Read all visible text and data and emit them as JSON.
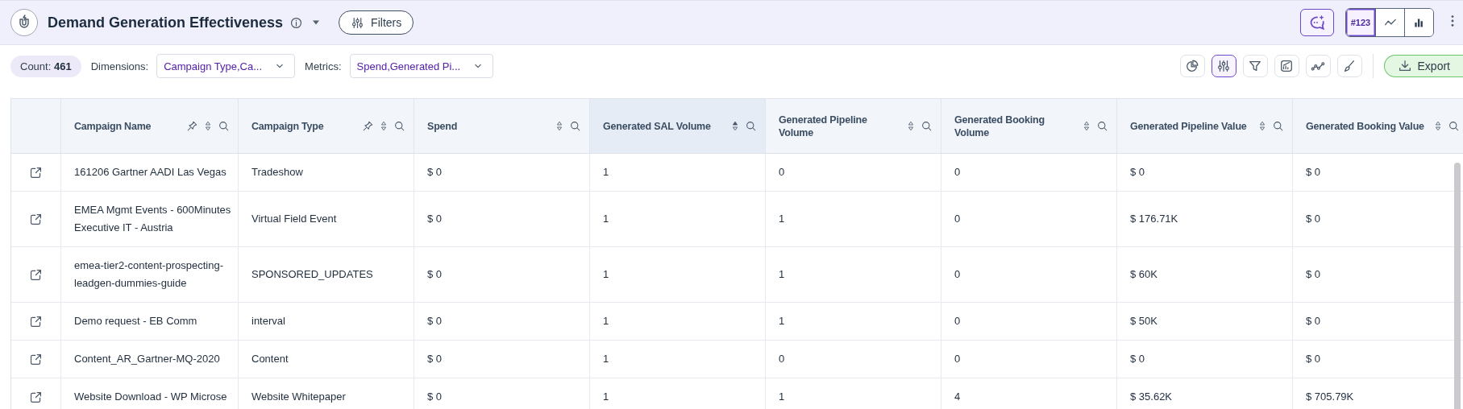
{
  "header": {
    "title": "Demand Generation Effectiveness",
    "filters_button": "Filters",
    "view_modes": [
      {
        "kind": "number",
        "label": "#123",
        "selected": true
      },
      {
        "kind": "line",
        "selected": false
      },
      {
        "kind": "bar",
        "selected": false
      }
    ]
  },
  "toolbar": {
    "count_label": "Count:",
    "count": "461",
    "dimensions_label": "Dimensions:",
    "dimensions_value": "Campaign Type,Ca...",
    "metrics_label": "Metrics:",
    "metrics_value": "Spend,Generated Pi...",
    "tools": [
      {
        "kind": "pie",
        "selected": false
      },
      {
        "kind": "sliders",
        "selected": true
      },
      {
        "kind": "funnel",
        "selected": false
      },
      {
        "kind": "chart",
        "selected": false
      },
      {
        "kind": "trend",
        "selected": false
      },
      {
        "kind": "brush",
        "selected": false
      }
    ],
    "export_button": "Export"
  },
  "table": {
    "columns": [
      {
        "label": "Campaign Name",
        "pinnable": true,
        "sorted": false
      },
      {
        "label": "Campaign Type",
        "pinnable": true,
        "sorted": false
      },
      {
        "label": "Spend",
        "pinnable": false,
        "sorted": false
      },
      {
        "label": "Generated SAL Volume",
        "pinnable": false,
        "sorted": true
      },
      {
        "label": "Generated Pipeline Volume",
        "pinnable": false,
        "sorted": false
      },
      {
        "label": "Generated Booking Volume",
        "pinnable": false,
        "sorted": false
      },
      {
        "label": "Generated Pipeline Value",
        "pinnable": false,
        "sorted": false
      },
      {
        "label": "Generated Booking Value",
        "pinnable": false,
        "sorted": false
      }
    ],
    "rows": [
      [
        "161206 Gartner AADI Las Vegas",
        "Tradeshow",
        "$ 0",
        "1",
        "0",
        "0",
        "$ 0",
        "$ 0"
      ],
      [
        "EMEA Mgmt Events - 600Minutes Executive IT - Austria",
        "Virtual Field Event",
        "$ 0",
        "1",
        "1",
        "0",
        "$ 176.71K",
        "$ 0"
      ],
      [
        "emea-tier2-content-prospecting-leadgen-dummies-guide",
        "SPONSORED_UPDATES",
        "$ 0",
        "1",
        "1",
        "0",
        "$ 60K",
        "$ 0"
      ],
      [
        "Demo request - EB Comm",
        "interval",
        "$ 0",
        "1",
        "1",
        "0",
        "$ 50K",
        "$ 0"
      ],
      [
        "Content_AR_Gartner-MQ-2020",
        "Content",
        "$ 0",
        "1",
        "0",
        "0",
        "$ 0",
        "$ 0"
      ],
      [
        "Website Download - WP Microse",
        "Website Whitepaper",
        "$ 0",
        "1",
        "1",
        "4",
        "$ 35.62K",
        "$ 705.79K"
      ]
    ]
  }
}
